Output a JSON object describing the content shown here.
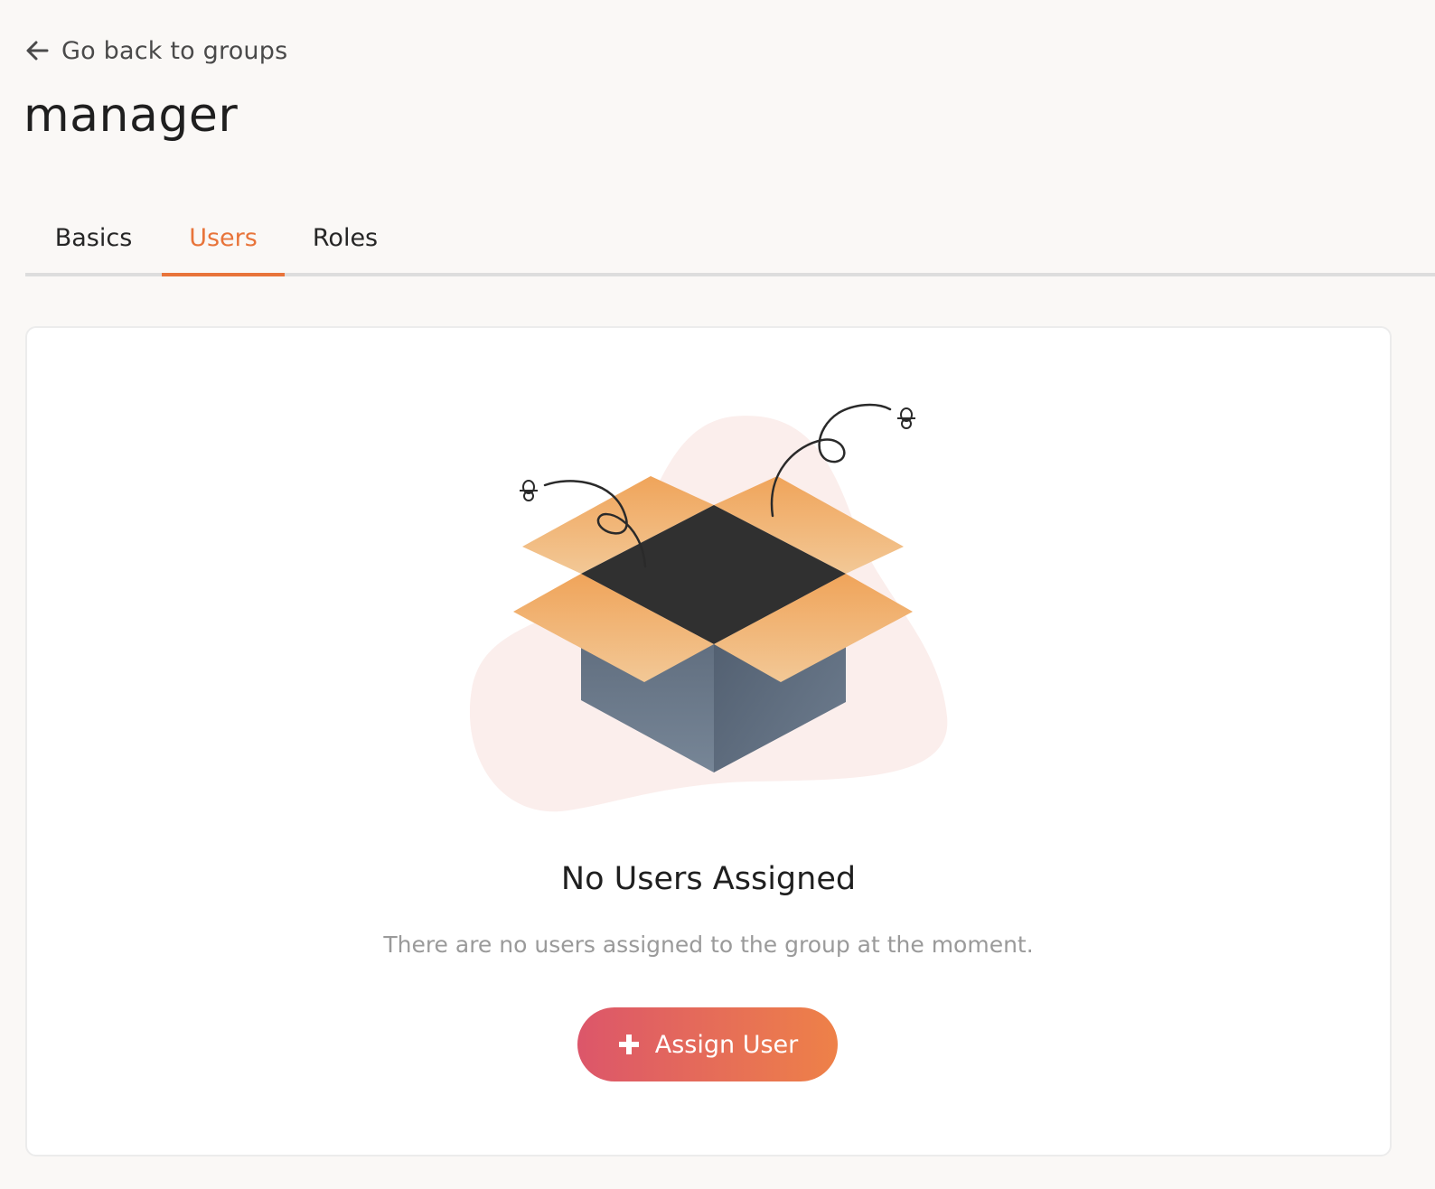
{
  "navigation": {
    "back_label": "Go back to groups",
    "back_icon": "arrow-left-icon"
  },
  "page": {
    "title": "manager"
  },
  "tabs": [
    {
      "label": "Basics",
      "active": false
    },
    {
      "label": "Users",
      "active": true
    },
    {
      "label": "Roles",
      "active": false
    }
  ],
  "empty_state": {
    "illustration": "open-box-illustration",
    "title": "No Users Assigned",
    "description": "There are no users assigned to the group at the moment.",
    "button_label": "Assign User",
    "button_icon": "plus-icon"
  },
  "colors": {
    "accent": "#e8743a",
    "button_gradient_start": "#dc566a",
    "button_gradient_end": "#ee8148",
    "background": "#faf8f6",
    "card": "#ffffff",
    "muted_text": "#9a9a9a"
  }
}
